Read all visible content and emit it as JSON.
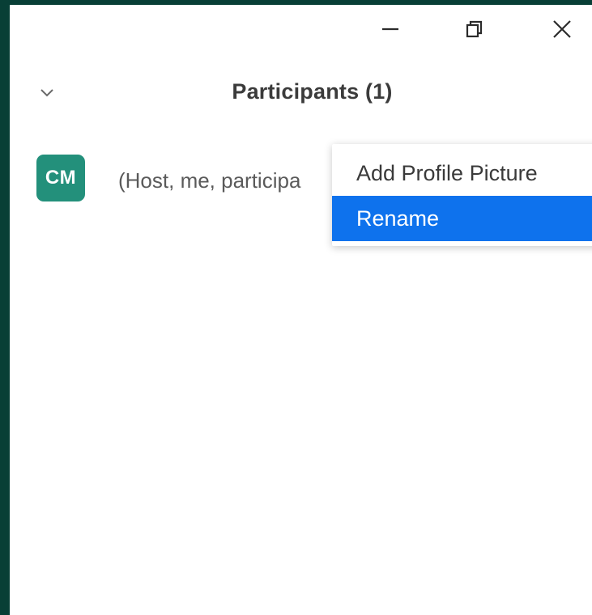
{
  "window": {
    "controls": {
      "minimize_icon": "minimize-icon",
      "restore_icon": "restore-icon",
      "close_icon": "close-icon"
    }
  },
  "panel": {
    "title": "Participants (1)",
    "collapse_icon": "chevron-down-icon"
  },
  "participants": [
    {
      "initials": "CM",
      "name": "(Host, me, participa",
      "avatar_color": "#23907b"
    }
  ],
  "context_menu": {
    "items": [
      {
        "label": "Add Profile Picture",
        "selected": false
      },
      {
        "label": "Rename",
        "selected": true
      }
    ]
  },
  "colors": {
    "background": "#083f36",
    "window": "#ffffff",
    "accent": "#0e72ed",
    "avatar": "#23907b"
  }
}
